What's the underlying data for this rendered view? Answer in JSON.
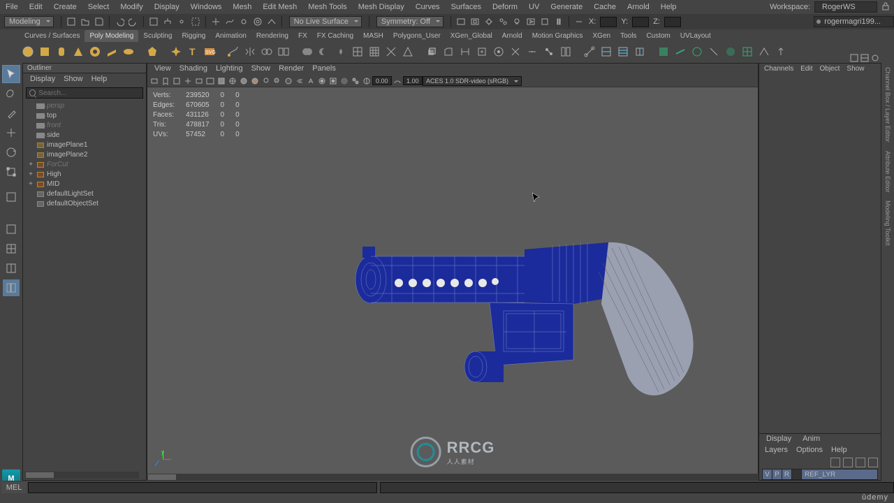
{
  "menubar": {
    "items": [
      "File",
      "Edit",
      "Create",
      "Select",
      "Modify",
      "Display",
      "Windows",
      "Mesh",
      "Edit Mesh",
      "Mesh Tools",
      "Mesh Display",
      "Curves",
      "Surfaces",
      "Deform",
      "UV",
      "Generate",
      "Cache",
      "Arnold",
      "Help"
    ]
  },
  "workspace": {
    "label": "Workspace:",
    "value": "RogerWS"
  },
  "statusline": {
    "mode": "Modeling",
    "live_surface": "No Live Surface",
    "symmetry": "Symmetry: Off",
    "x_label": "X:",
    "y_label": "Y:",
    "z_label": "Z:",
    "x_val": "",
    "y_val": "",
    "z_val": "",
    "account": "rogermagri199..."
  },
  "shelftabs": [
    "Curves / Surfaces",
    "Poly Modeling",
    "Sculpting",
    "Rigging",
    "Animation",
    "Rendering",
    "FX",
    "FX Caching",
    "MASH",
    "Polygons_User",
    "XGen_Global",
    "Arnold",
    "Motion Graphics",
    "XGen",
    "Tools",
    "Custom",
    "UVLayout"
  ],
  "active_shelf_tab": "Poly Modeling",
  "outliner": {
    "title": "Outliner",
    "menu": [
      "Display",
      "Show",
      "Help"
    ],
    "search_ph": "Search...",
    "nodes": [
      {
        "t": "cam",
        "lbl": "persp",
        "dim": true,
        "ind": 1
      },
      {
        "t": "cam",
        "lbl": "top",
        "dim": false,
        "ind": 1
      },
      {
        "t": "cam",
        "lbl": "front",
        "dim": true,
        "ind": 1,
        "alpha": 0.5
      },
      {
        "t": "cam",
        "lbl": "side",
        "dim": false,
        "ind": 1
      },
      {
        "t": "plane",
        "lbl": "imagePlane1",
        "dim": false,
        "ind": 1
      },
      {
        "t": "plane",
        "lbl": "imagePlane2",
        "dim": false,
        "ind": 1
      },
      {
        "t": "grp",
        "lbl": "ForCut",
        "dim": true,
        "ind": 1,
        "tog": "+"
      },
      {
        "t": "grp",
        "lbl": "High",
        "dim": false,
        "ind": 1,
        "tog": "+"
      },
      {
        "t": "grp",
        "lbl": "MID",
        "dim": false,
        "ind": 1,
        "tog": "+"
      },
      {
        "t": "set",
        "lbl": "defaultLightSet",
        "dim": false,
        "ind": 1
      },
      {
        "t": "set",
        "lbl": "defaultObjectSet",
        "dim": false,
        "ind": 1
      }
    ]
  },
  "viewport": {
    "menu": [
      "View",
      "Shading",
      "Lighting",
      "Show",
      "Render",
      "Panels"
    ],
    "exposure": "0.00",
    "gamma": "1.00",
    "colorspace": "ACES 1.0 SDR-video (sRGB)"
  },
  "hud": {
    "rows": [
      {
        "k": "Verts:",
        "a": "239520",
        "b": "0",
        "c": "0"
      },
      {
        "k": "Edges:",
        "a": "670605",
        "b": "0",
        "c": "0"
      },
      {
        "k": "Faces:",
        "a": "431126",
        "b": "0",
        "c": "0"
      },
      {
        "k": "Tris:",
        "a": "478817",
        "b": "0",
        "c": "0"
      },
      {
        "k": "UVs:",
        "a": "57452",
        "b": "0",
        "c": "0"
      }
    ]
  },
  "watermark": {
    "text": "RRCG",
    "sub": "人人素材"
  },
  "channelbox": {
    "menu": [
      "Channels",
      "Edit",
      "Object",
      "Show"
    ],
    "layers": {
      "tabs": [
        "Display",
        "Anim"
      ],
      "menu": [
        "Layers",
        "Options",
        "Help"
      ],
      "layer": {
        "v": "V",
        "p": "P",
        "r": "R",
        "name": "REF_LYR"
      }
    },
    "vtabs": [
      "Channel Box / Layer Editor",
      "Attribute Editor",
      "Modeling Toolkit"
    ]
  },
  "cmdline": {
    "lang": "MEL"
  },
  "udemy": "ûdemy"
}
